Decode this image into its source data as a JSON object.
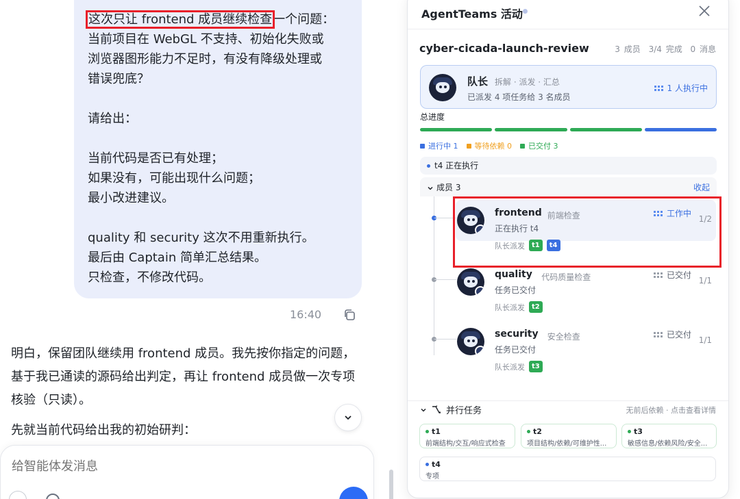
{
  "chat": {
    "user_lines": [
      {
        "pre": "",
        "highlight": "这次只让 frontend 成员继续检查",
        "post": "一个问题："
      },
      {
        "text": "当前项目在 WebGL 不支持、初始化失败或"
      },
      {
        "text": "浏览器图形能力不足时，有没有降级处理或"
      },
      {
        "text": "错误兜底？"
      },
      {
        "text": ""
      },
      {
        "text": "请给出："
      },
      {
        "text": ""
      },
      {
        "text": "当前代码是否已有处理；"
      },
      {
        "text": "如果没有，可能出现什么问题；"
      },
      {
        "text": "最小改进建议。"
      },
      {
        "text": ""
      },
      {
        "text": "quality 和 security 这次不用重新执行。"
      },
      {
        "text": "最后由 Captain 简单汇总结果。"
      },
      {
        "text": "只检查，不修改代码。"
      }
    ],
    "time": "16:40",
    "ai_paragraph_1": "明白，保留团队继续用 frontend 成员。我先按你指定的问题，基于我已通读的源码给出判定，再让 frontend 成员做一次专项核验（只读）。",
    "ai_paragraph_2": "先就当前代码给出我的初始研判：",
    "composer_placeholder": "给智能体发消息"
  },
  "panel": {
    "title": "AgentTeams 活动",
    "team_name": "cyber-cicada-launch-review",
    "stats": {
      "members": "3 成员",
      "done": "3/4 完成",
      "messages": "0 消息"
    },
    "leader": {
      "title": "队长",
      "subtitle": "拆解 · 派发 · 汇总",
      "desc": "已派发 4 项任务给 3 名成员",
      "exec": "1 人执行中"
    },
    "progress_label": "总进度",
    "progress": {
      "done_fraction": 0.75,
      "segments": [
        "done",
        "done",
        "done",
        "running"
      ]
    },
    "legend": [
      {
        "label": "进行中 1",
        "color": "#3a6fe0"
      },
      {
        "label": "等待依赖 0",
        "color": "#f0a020"
      },
      {
        "label": "已交付 3",
        "color": "#2eaa55"
      }
    ],
    "current": "t4 正在执行",
    "members_label": "成员 3",
    "collapse": "收起",
    "members": [
      {
        "name": "frontend",
        "role": "前端检查",
        "task": "正在执行 t4",
        "status": "工作中",
        "count": "1/2",
        "assign": "队长派发",
        "tags": [
          {
            "label": "t1",
            "color": "#2eaa55"
          },
          {
            "label": "t4",
            "color": "#3a6fe0"
          }
        ],
        "active": true
      },
      {
        "name": "quality",
        "role": "代码质量检查",
        "task": "任务已交付",
        "status": "已交付",
        "count": "1/1",
        "assign": "队长派发",
        "tags": [
          {
            "label": "t2",
            "color": "#2eaa55"
          }
        ],
        "active": false
      },
      {
        "name": "security",
        "role": "安全检查",
        "task": "任务已交付",
        "status": "已交付",
        "count": "1/1",
        "assign": "队长派发",
        "tags": [
          {
            "label": "t3",
            "color": "#2eaa55"
          }
        ],
        "active": false
      }
    ],
    "parallel_title": "并行任务",
    "parallel_note": "无前后依赖 · 点击查看详情",
    "tasks": [
      {
        "id": "t1",
        "desc": "前端结构/交互/响应式检查",
        "color": "#2eaa55"
      },
      {
        "id": "t2",
        "desc": "项目结构/依赖/可维护性...",
        "color": "#2eaa55"
      },
      {
        "id": "t3",
        "desc": "敏感信息/依赖风险/安全...",
        "color": "#2eaa55"
      },
      {
        "id": "t4",
        "desc": "专项",
        "color": "#3a6fe0"
      }
    ],
    "colors": {
      "accent": "#3a6fe0",
      "done": "#2eaa55",
      "waiting": "#f0a020"
    }
  }
}
